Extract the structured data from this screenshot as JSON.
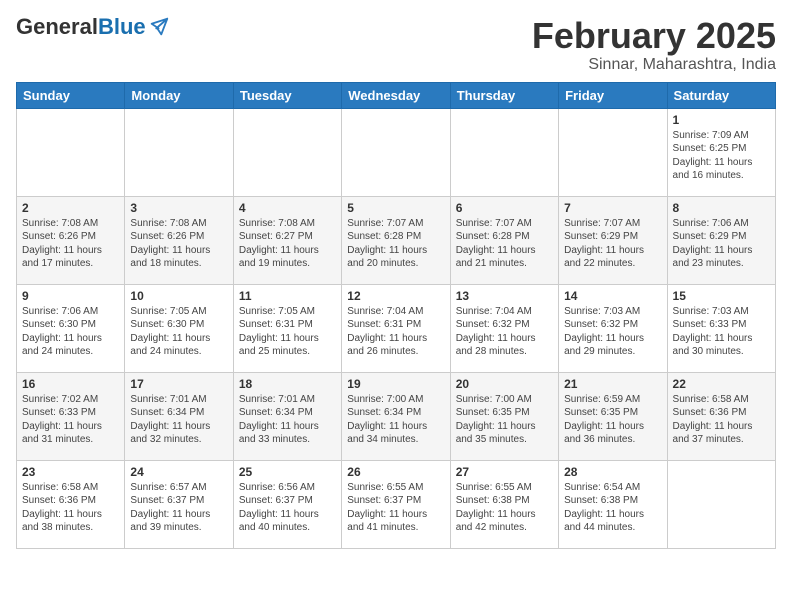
{
  "header": {
    "logo_general": "General",
    "logo_blue": "Blue",
    "month_title": "February 2025",
    "location": "Sinnar, Maharashtra, India"
  },
  "weekdays": [
    "Sunday",
    "Monday",
    "Tuesday",
    "Wednesday",
    "Thursday",
    "Friday",
    "Saturday"
  ],
  "weeks": [
    [
      {
        "day": "",
        "info": ""
      },
      {
        "day": "",
        "info": ""
      },
      {
        "day": "",
        "info": ""
      },
      {
        "day": "",
        "info": ""
      },
      {
        "day": "",
        "info": ""
      },
      {
        "day": "",
        "info": ""
      },
      {
        "day": "1",
        "info": "Sunrise: 7:09 AM\nSunset: 6:25 PM\nDaylight: 11 hours\nand 16 minutes."
      }
    ],
    [
      {
        "day": "2",
        "info": "Sunrise: 7:08 AM\nSunset: 6:26 PM\nDaylight: 11 hours\nand 17 minutes."
      },
      {
        "day": "3",
        "info": "Sunrise: 7:08 AM\nSunset: 6:26 PM\nDaylight: 11 hours\nand 18 minutes."
      },
      {
        "day": "4",
        "info": "Sunrise: 7:08 AM\nSunset: 6:27 PM\nDaylight: 11 hours\nand 19 minutes."
      },
      {
        "day": "5",
        "info": "Sunrise: 7:07 AM\nSunset: 6:28 PM\nDaylight: 11 hours\nand 20 minutes."
      },
      {
        "day": "6",
        "info": "Sunrise: 7:07 AM\nSunset: 6:28 PM\nDaylight: 11 hours\nand 21 minutes."
      },
      {
        "day": "7",
        "info": "Sunrise: 7:07 AM\nSunset: 6:29 PM\nDaylight: 11 hours\nand 22 minutes."
      },
      {
        "day": "8",
        "info": "Sunrise: 7:06 AM\nSunset: 6:29 PM\nDaylight: 11 hours\nand 23 minutes."
      }
    ],
    [
      {
        "day": "9",
        "info": "Sunrise: 7:06 AM\nSunset: 6:30 PM\nDaylight: 11 hours\nand 24 minutes."
      },
      {
        "day": "10",
        "info": "Sunrise: 7:05 AM\nSunset: 6:30 PM\nDaylight: 11 hours\nand 24 minutes."
      },
      {
        "day": "11",
        "info": "Sunrise: 7:05 AM\nSunset: 6:31 PM\nDaylight: 11 hours\nand 25 minutes."
      },
      {
        "day": "12",
        "info": "Sunrise: 7:04 AM\nSunset: 6:31 PM\nDaylight: 11 hours\nand 26 minutes."
      },
      {
        "day": "13",
        "info": "Sunrise: 7:04 AM\nSunset: 6:32 PM\nDaylight: 11 hours\nand 28 minutes."
      },
      {
        "day": "14",
        "info": "Sunrise: 7:03 AM\nSunset: 6:32 PM\nDaylight: 11 hours\nand 29 minutes."
      },
      {
        "day": "15",
        "info": "Sunrise: 7:03 AM\nSunset: 6:33 PM\nDaylight: 11 hours\nand 30 minutes."
      }
    ],
    [
      {
        "day": "16",
        "info": "Sunrise: 7:02 AM\nSunset: 6:33 PM\nDaylight: 11 hours\nand 31 minutes."
      },
      {
        "day": "17",
        "info": "Sunrise: 7:01 AM\nSunset: 6:34 PM\nDaylight: 11 hours\nand 32 minutes."
      },
      {
        "day": "18",
        "info": "Sunrise: 7:01 AM\nSunset: 6:34 PM\nDaylight: 11 hours\nand 33 minutes."
      },
      {
        "day": "19",
        "info": "Sunrise: 7:00 AM\nSunset: 6:34 PM\nDaylight: 11 hours\nand 34 minutes."
      },
      {
        "day": "20",
        "info": "Sunrise: 7:00 AM\nSunset: 6:35 PM\nDaylight: 11 hours\nand 35 minutes."
      },
      {
        "day": "21",
        "info": "Sunrise: 6:59 AM\nSunset: 6:35 PM\nDaylight: 11 hours\nand 36 minutes."
      },
      {
        "day": "22",
        "info": "Sunrise: 6:58 AM\nSunset: 6:36 PM\nDaylight: 11 hours\nand 37 minutes."
      }
    ],
    [
      {
        "day": "23",
        "info": "Sunrise: 6:58 AM\nSunset: 6:36 PM\nDaylight: 11 hours\nand 38 minutes."
      },
      {
        "day": "24",
        "info": "Sunrise: 6:57 AM\nSunset: 6:37 PM\nDaylight: 11 hours\nand 39 minutes."
      },
      {
        "day": "25",
        "info": "Sunrise: 6:56 AM\nSunset: 6:37 PM\nDaylight: 11 hours\nand 40 minutes."
      },
      {
        "day": "26",
        "info": "Sunrise: 6:55 AM\nSunset: 6:37 PM\nDaylight: 11 hours\nand 41 minutes."
      },
      {
        "day": "27",
        "info": "Sunrise: 6:55 AM\nSunset: 6:38 PM\nDaylight: 11 hours\nand 42 minutes."
      },
      {
        "day": "28",
        "info": "Sunrise: 6:54 AM\nSunset: 6:38 PM\nDaylight: 11 hours\nand 44 minutes."
      },
      {
        "day": "",
        "info": ""
      }
    ]
  ]
}
